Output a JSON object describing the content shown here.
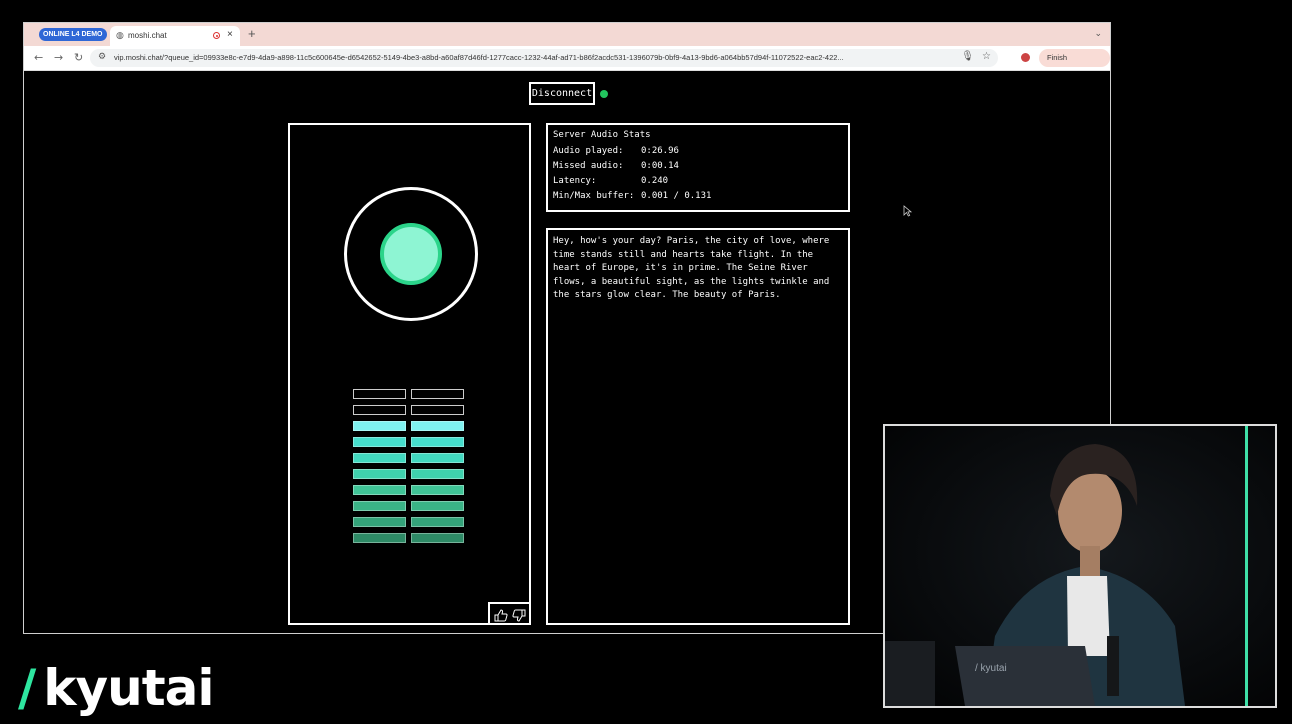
{
  "browser": {
    "badge": "ONLINE L4 DEMO",
    "tab_title": "moshi.chat",
    "tab_close": "×",
    "new_tab": "+",
    "tab_menu": "⌄",
    "nav_back": "←",
    "nav_forward": "→",
    "nav_reload": "↻",
    "url": "vip.moshi.chat/?queue_id=09933e8c-e7d9-4da9-a898-11c5c600645e-d6542652-5149-4be3-a8bd-a60af87d46fd-1277cacc-1232-44af-ad71-b86f2acdc531-1396079b-0bf9-4a13-9bd6-a064bb57d94f-11072522-eac2-422...",
    "update_label": "Finish update",
    "update_menu": "⋮"
  },
  "app": {
    "disconnect_label": "Disconnect",
    "status_color": "#22c55e",
    "stats": {
      "title": "Server Audio Stats",
      "rows": [
        {
          "label": "Audio played:",
          "value": "0:26.96"
        },
        {
          "label": "Missed audio:",
          "value": "0:00.14"
        },
        {
          "label": "Latency:",
          "value": "0.240"
        },
        {
          "label": "Min/Max buffer:",
          "value": "0.001 / 0.131"
        }
      ]
    },
    "transcript": "Hey, how's your day? Paris, the city of love, where time stands still and hearts take flight. In the heart of Europe, it's in prime. The Seine River flows, a beautiful sight, as the lights twinkle and the stars glow clear. The beauty of Paris.",
    "meter": {
      "levels": 10,
      "active_levels": 8,
      "colors": [
        "#2e8a66",
        "#34a37a",
        "#3ab386",
        "#40c497",
        "#3fd1ad",
        "#42d8bf",
        "#46ddcc",
        "#7ff2f0",
        "#8c9cf0",
        "#000000"
      ]
    }
  },
  "logo_text": "kyutai",
  "logo_slash": "/",
  "camera_label": "/ kyutai"
}
